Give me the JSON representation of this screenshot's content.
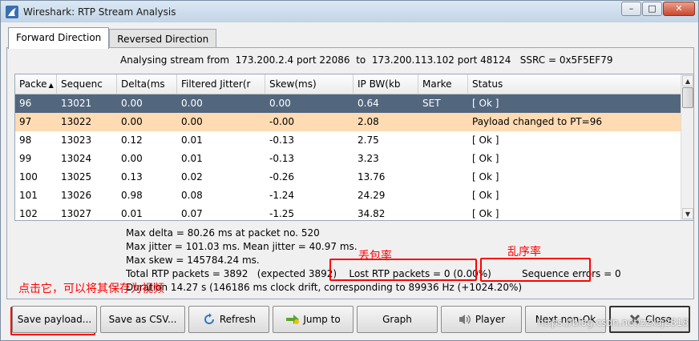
{
  "window": {
    "title": "Wireshark: RTP Stream Analysis",
    "minimize": "–",
    "maximize": "□",
    "close": "✕"
  },
  "tabs": [
    {
      "label": "Forward Direction",
      "active": true
    },
    {
      "label": "Reversed Direction",
      "active": false
    }
  ],
  "stream_info": "Analysing stream from  173.200.2.4 port 22086  to  173.200.113.102 port 48124   SSRC = 0x5F5EF79",
  "table": {
    "headers": [
      "Packe",
      "Sequenc",
      "Delta(ms",
      "Filtered Jitter(r",
      "Skew(ms)",
      "IP BW(kb",
      "Marke",
      "Status"
    ],
    "rows": [
      [
        "96",
        "13021",
        "0.00",
        "0.00",
        "0.00",
        "0.64",
        "SET",
        "[ Ok ]"
      ],
      [
        "97",
        "13022",
        "0.00",
        "0.00",
        "-0.00",
        "2.08",
        "",
        "Payload changed to PT=96"
      ],
      [
        "98",
        "13023",
        "0.12",
        "0.01",
        "-0.13",
        "2.75",
        "",
        "[ Ok ]"
      ],
      [
        "99",
        "13024",
        "0.00",
        "0.01",
        "-0.13",
        "3.23",
        "",
        "[ Ok ]"
      ],
      [
        "100",
        "13025",
        "0.13",
        "0.02",
        "-0.26",
        "13.76",
        "",
        "[ Ok ]"
      ],
      [
        "101",
        "13026",
        "0.98",
        "0.08",
        "-1.24",
        "24.29",
        "",
        "[ Ok ]"
      ],
      [
        "102",
        "13027",
        "0.01",
        "0.07",
        "-1.25",
        "34.82",
        "",
        "[ Ok ]"
      ]
    ]
  },
  "summary": {
    "max_delta": "Max delta = 80.26 ms at packet no. 520",
    "max_jitter": "Max jitter = 101.03 ms. Mean jitter = 40.97 ms.",
    "max_skew": "Max skew = 145784.24 ms.",
    "total": "Total RTP packets = 3892   (expected 3892)",
    "lost": "Lost RTP packets = 0 (0.00%)",
    "seq_errors": "Sequence errors = 0",
    "duration": "Duration 14.27 s (146186 ms clock drift, corresponding to 89936 Hz (+1024.20%)"
  },
  "annotations": {
    "lost_rate": "丢包率",
    "disorder_rate": "乱序率",
    "save_hint": "点击它，可以将其保存为视频"
  },
  "buttons": {
    "save_payload": "Save payload...",
    "save_csv": "Save as CSV...",
    "refresh": "Refresh",
    "jump_to": "Jump to",
    "graph": "Graph",
    "player": "Player",
    "next_nonok": "Next non-Ok",
    "close": "Close"
  },
  "watermark": "https://blog.csdn.net/zzxsj2818",
  "colors": {
    "selected_row": "#52677e",
    "warning_row": "#ffdbb3",
    "annotation": "#ff0000"
  }
}
